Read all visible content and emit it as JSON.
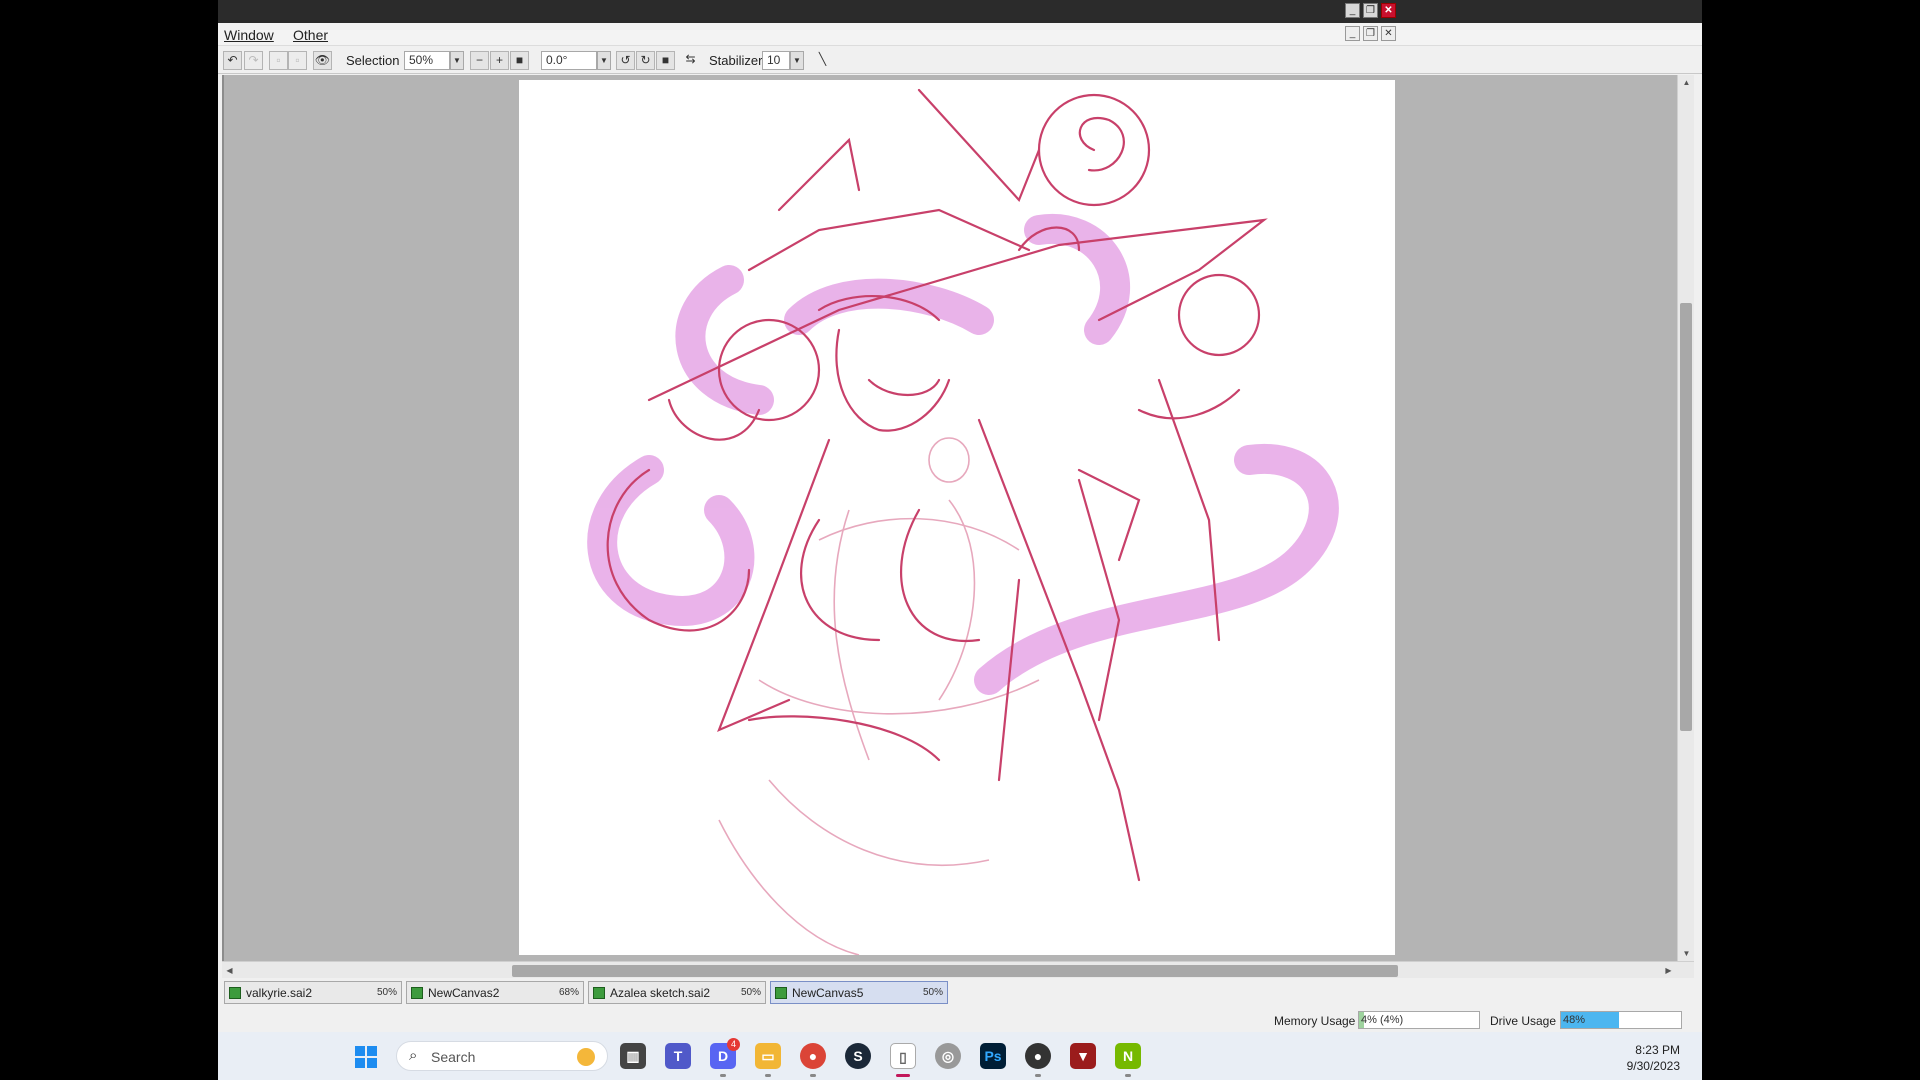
{
  "menu": {
    "window": "Window",
    "other": "Other"
  },
  "toolbar": {
    "selection_label": "Selection",
    "zoom_value": "50%",
    "rotation_value": "0.0°",
    "stabilizer_label": "Stabilizer",
    "stabilizer_value": "10"
  },
  "tabs": [
    {
      "name": "valkyrie.sai2",
      "zoom": "50%"
    },
    {
      "name": "NewCanvas2",
      "zoom": "68%"
    },
    {
      "name": "Azalea sketch.sai2",
      "zoom": "50%"
    },
    {
      "name": "NewCanvas5",
      "zoom": "50%"
    }
  ],
  "status": {
    "memory_label": "Memory Usage",
    "memory_value": "4% (4%)",
    "memory_fraction": 0.04,
    "drive_label": "Drive Usage",
    "drive_value": "48%",
    "drive_fraction": 0.48
  },
  "taskbar": {
    "search_placeholder": "Search",
    "time": "8:23 PM",
    "date": "9/30/2023",
    "discord_badge": "4"
  },
  "colors": {
    "sketch_line": "#c8406a",
    "sketch_light": "#e7a8bd",
    "sketch_fill": "#e6a6e6",
    "active_tab": "#d6def0",
    "memory_bar": "#9ed39e",
    "drive_bar": "#4cb6f0"
  }
}
